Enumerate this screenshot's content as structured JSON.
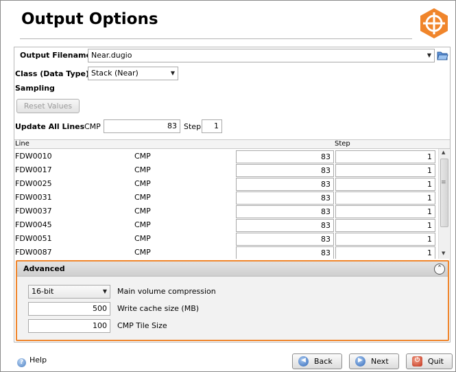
{
  "header": {
    "title": "Output Options",
    "logo_icon": "crosshair-icon",
    "logo_color": "#f0852b"
  },
  "output_filename": {
    "label": "Output Filename",
    "value": "Near.dugio"
  },
  "class_type": {
    "label": "Class (Data Type)",
    "value": "Stack (Near)"
  },
  "sampling": {
    "label": "Sampling",
    "reset_label": "Reset Values"
  },
  "update_all": {
    "label": "Update All Lines",
    "type": "CMP",
    "cmp_value": "83",
    "step_label": "Step",
    "step_value": "1"
  },
  "table": {
    "headers": {
      "line": "Line",
      "step": "Step"
    },
    "rows": [
      {
        "line": "FDW0010",
        "type": "CMP",
        "cmp": "83",
        "step": "1"
      },
      {
        "line": "FDW0017",
        "type": "CMP",
        "cmp": "83",
        "step": "1"
      },
      {
        "line": "FDW0025",
        "type": "CMP",
        "cmp": "83",
        "step": "1"
      },
      {
        "line": "FDW0031",
        "type": "CMP",
        "cmp": "83",
        "step": "1"
      },
      {
        "line": "FDW0037",
        "type": "CMP",
        "cmp": "83",
        "step": "1"
      },
      {
        "line": "FDW0045",
        "type": "CMP",
        "cmp": "83",
        "step": "1"
      },
      {
        "line": "FDW0051",
        "type": "CMP",
        "cmp": "83",
        "step": "1"
      },
      {
        "line": "FDW0087",
        "type": "CMP",
        "cmp": "83",
        "step": "1"
      }
    ]
  },
  "advanced": {
    "title": "Advanced",
    "compression": {
      "value": "16-bit",
      "label": "Main volume compression"
    },
    "cache": {
      "value": "500",
      "label": "Write cache size (MB)"
    },
    "tile": {
      "value": "100",
      "label": "CMP Tile Size"
    },
    "accent_color": "#f0852b"
  },
  "footer": {
    "help": "Help",
    "back": "Back",
    "next": "Next",
    "quit": "Quit"
  }
}
